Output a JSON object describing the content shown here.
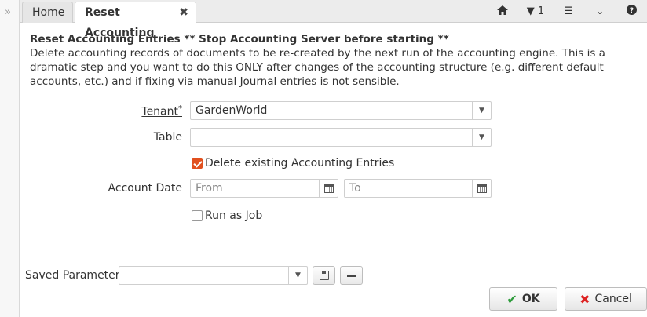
{
  "tabs": [
    {
      "label": "Home",
      "active": false
    },
    {
      "label": "Reset Accounting",
      "active": true
    }
  ],
  "toolbar": {
    "home_icon": "home-icon",
    "window_count": "1",
    "menu_icon": "hamburger-menu-icon",
    "collapse_icon": "double-chevron-down-icon",
    "help_icon": "help-circle-icon"
  },
  "description": {
    "title": "Reset Accounting Entries ** Stop Accounting Server before starting **",
    "body": "Delete accounting records of documents to be re-created by the next run of the accounting engine. This is a dramatic step and you want to do this ONLY after changes of the accounting structure (e.g. different default accounts, etc.) and if fixing via manual Journal entries is not sensible."
  },
  "form": {
    "tenant": {
      "label": "Tenant",
      "required_mark": "*",
      "value": "GardenWorld"
    },
    "table": {
      "label": "Table",
      "value": ""
    },
    "delete_existing": {
      "label": "Delete existing Accounting Entries",
      "checked": true
    },
    "account_date": {
      "label": "Account Date",
      "from_placeholder": "From",
      "to_placeholder": "To"
    },
    "run_as_job": {
      "label": "Run as Job",
      "checked": false
    }
  },
  "saved_parameters": {
    "label": "Saved Parameters",
    "value": ""
  },
  "buttons": {
    "ok": "OK",
    "cancel": "Cancel"
  },
  "colors": {
    "accent": "#e1501e",
    "ok_icon": "#2e9c3c",
    "cancel_icon": "#dd2222"
  }
}
